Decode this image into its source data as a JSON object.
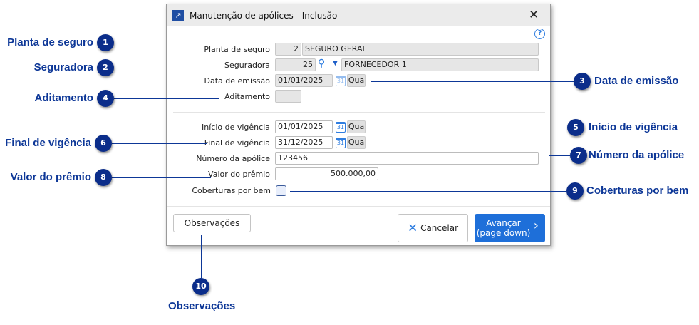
{
  "window": {
    "title": "Manutenção de apólices - Inclusão",
    "close": "✕",
    "help": "?"
  },
  "fields": {
    "planta": {
      "label": "Planta de seguro",
      "code": "2",
      "name": "SEGURO GERAL"
    },
    "seguradora": {
      "label": "Seguradora",
      "code": "25",
      "name": "FORNECEDOR 1"
    },
    "emissao": {
      "label": "Data de emissão",
      "value": "01/01/2025",
      "weekday": "Qua"
    },
    "aditamento": {
      "label": "Aditamento",
      "value": ""
    },
    "inicio": {
      "label": "Início de vigência",
      "value": "01/01/2025",
      "weekday": "Qua"
    },
    "final": {
      "label": "Final de vigência",
      "value": "31/12/2025",
      "weekday": "Qua"
    },
    "numero": {
      "label": "Número da apólice",
      "value": "123456"
    },
    "premio": {
      "label": "Valor do prêmio",
      "value": "500.000,00"
    },
    "coberturas": {
      "label": "Coberturas por bem",
      "checked": false
    }
  },
  "calendar_day": "31",
  "buttons": {
    "observacoes": "Observações",
    "cancelar": "Cancelar",
    "avancar_1": "Avançar",
    "avancar_2": "(page down)"
  },
  "callouts": [
    {
      "n": "1",
      "label": "Planta de seguro"
    },
    {
      "n": "2",
      "label": "Seguradora"
    },
    {
      "n": "3",
      "label": "Data de emissão"
    },
    {
      "n": "4",
      "label": "Aditamento"
    },
    {
      "n": "5",
      "label": "Início de vigência"
    },
    {
      "n": "6",
      "label": "Final de vigência"
    },
    {
      "n": "7",
      "label": "Número da apólice"
    },
    {
      "n": "8",
      "label": "Valor do prêmio"
    },
    {
      "n": "9",
      "label": "Coberturas por bem"
    },
    {
      "n": "10",
      "label": "Observações"
    }
  ],
  "colors": {
    "callout": "#0b2d8a",
    "accent": "#1e6fd9"
  }
}
